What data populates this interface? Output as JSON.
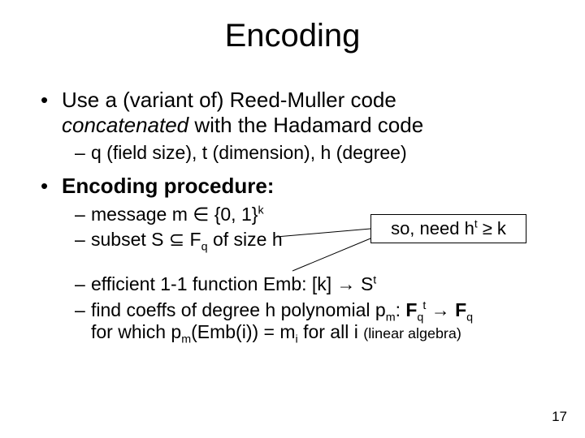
{
  "title": "Encoding",
  "b1_line1_a": "Use a (variant of) ",
  "b1_line1_b": "Reed-Muller code",
  "b1_line2_a": "concatenated",
  "b1_line2_b": " with the Hadamard code",
  "b1_sub": "q (field size), t (dimension), h (degree)",
  "b2_head": "Encoding procedure:",
  "b2_s1_a": "message m ",
  "sym_in": "∈",
  "b2_s1_b": " {0, 1}",
  "exp_k": "k",
  "b2_s2_a": "subset S ",
  "sym_subeq": "⊆",
  "b2_s2_b": " F",
  "sub_q": "q",
  "b2_s2_c": " of size h",
  "callout_a": "so, need h",
  "exp_t": "t",
  "sym_ge": " ≥ ",
  "callout_b": "k",
  "b2_s3_a": "efficient 1-1 function Emb: [k] → S",
  "b2_s4_a": "find coeffs of degree h polynomial p",
  "sub_m": "m",
  "b2_s4_b": ": ",
  "boldF": "F",
  "arrow": " → ",
  "b2_s4_cont_a": "for which p",
  "b2_s4_cont_b": "(Emb(i)) = m",
  "sub_i": "i",
  "b2_s4_cont_c": " for all i ",
  "b2_s4_note": "(linear algebra)",
  "page": "17"
}
